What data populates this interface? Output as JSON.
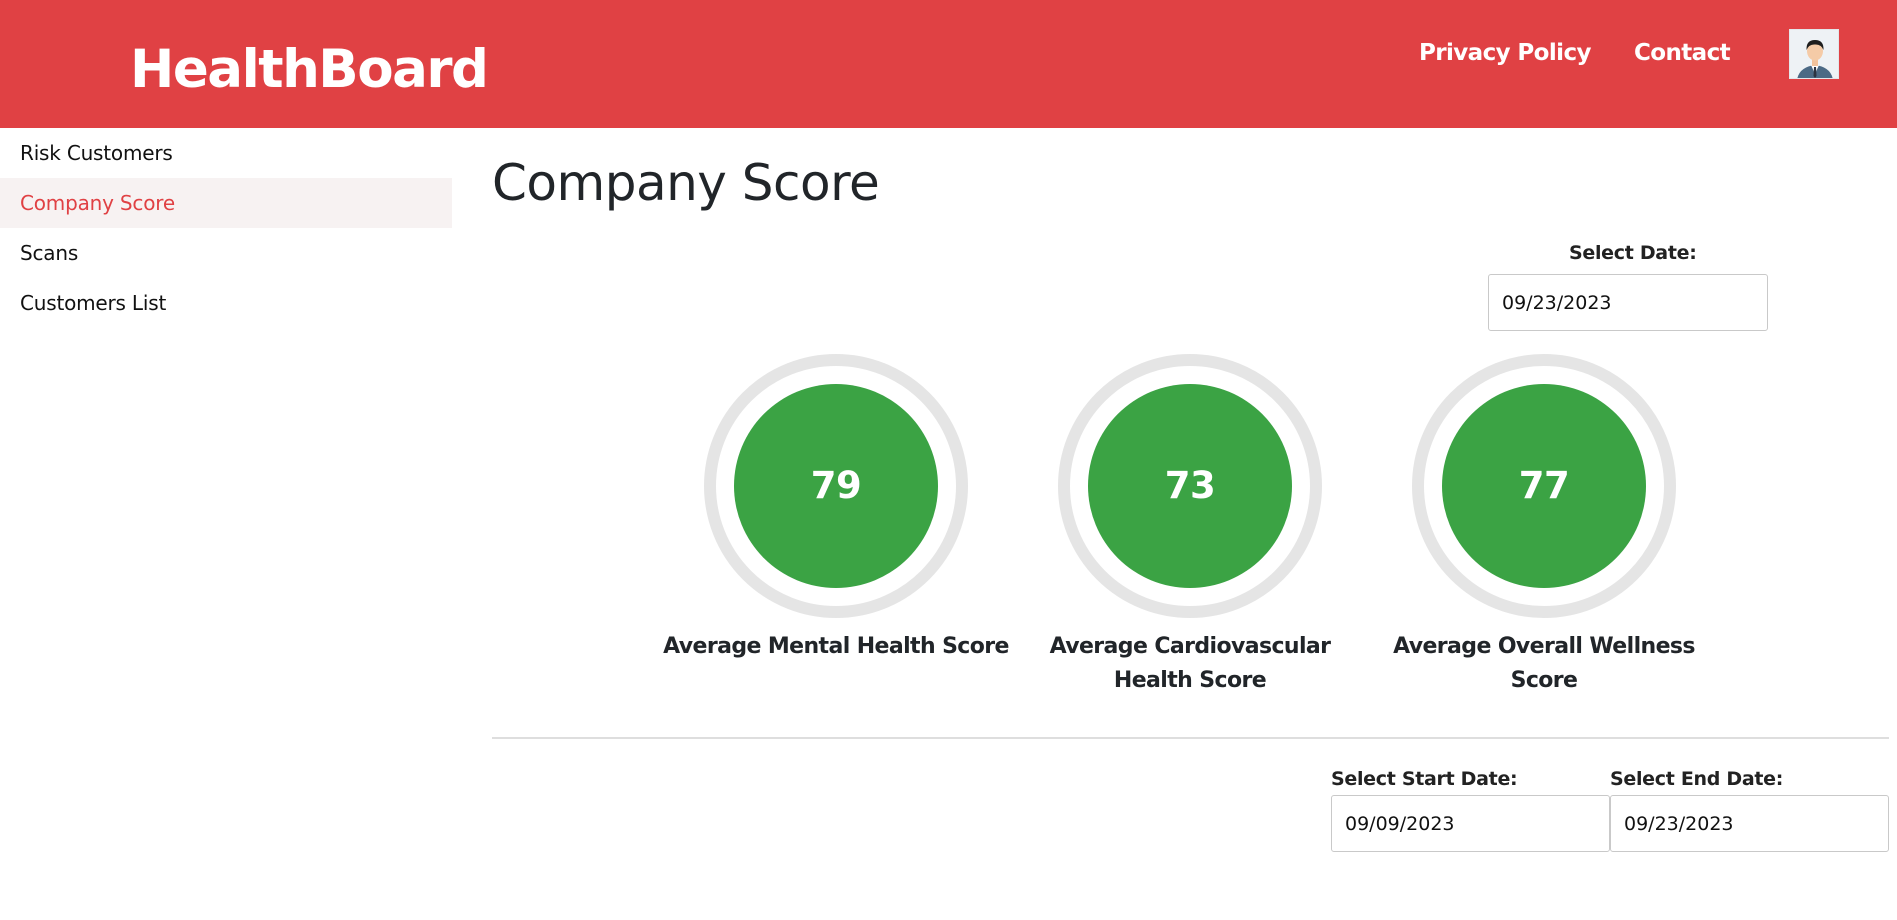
{
  "header": {
    "brand": "HealthBoard",
    "nav": {
      "privacy": "Privacy Policy",
      "contact": "Contact"
    },
    "avatar_icon": "user-avatar-icon"
  },
  "sidebar": {
    "items": [
      {
        "label": "Risk Customers",
        "active": false
      },
      {
        "label": "Company Score",
        "active": true
      },
      {
        "label": "Scans",
        "active": false
      },
      {
        "label": "Customers List",
        "active": false
      }
    ]
  },
  "main": {
    "title": "Company Score",
    "select_date": {
      "label": "Select Date:",
      "value": "09/23/2023"
    },
    "scores": [
      {
        "value": "79",
        "label": "Average Mental Health Score"
      },
      {
        "value": "73",
        "label": "Average Cardiovascular Health Score"
      },
      {
        "value": "77",
        "label": "Average Overall Wellness Score"
      }
    ],
    "range": {
      "start": {
        "label": "Select Start Date:",
        "value": "09/09/2023"
      },
      "end": {
        "label": "Select End Date:",
        "value": "09/23/2023"
      }
    }
  },
  "colors": {
    "brand": "#e04144",
    "score_good": "#3ba344",
    "ring": "#e5e5e5",
    "active_bg": "#f7f2f2"
  }
}
